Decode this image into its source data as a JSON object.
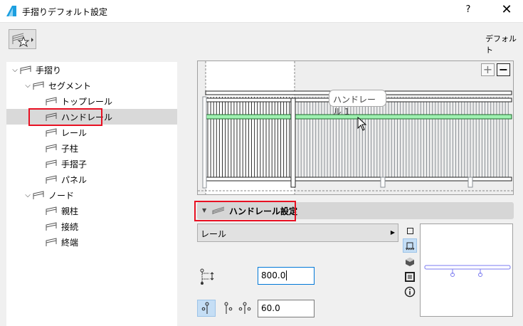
{
  "window": {
    "title": "手摺りデフォルト設定",
    "help": "?",
    "close": "✕"
  },
  "toolbar": {
    "default_label": "デフォルト"
  },
  "tree": [
    {
      "label": "手摺り",
      "level": 0,
      "expanded": true
    },
    {
      "label": "セグメント",
      "level": 1,
      "expanded": true
    },
    {
      "label": "トップレール",
      "level": 2
    },
    {
      "label": "ハンドレール",
      "level": 2,
      "selected": true
    },
    {
      "label": "レール",
      "level": 2
    },
    {
      "label": "子柱",
      "level": 2
    },
    {
      "label": "手摺子",
      "level": 2
    },
    {
      "label": "パネル",
      "level": 2
    },
    {
      "label": "ノード",
      "level": 1,
      "expanded": true
    },
    {
      "label": "親柱",
      "level": 2
    },
    {
      "label": "接続",
      "level": 2
    },
    {
      "label": "終端",
      "level": 2
    }
  ],
  "preview": {
    "tooltip": "ハンドレール 1",
    "zoom_in": "+",
    "zoom_out": "−"
  },
  "section": {
    "title": "ハンドレール設定"
  },
  "settings": {
    "rail_type": "レール",
    "height_value": "800.0",
    "offset_value": "60.0"
  },
  "colors": {
    "highlight": "#e81123",
    "handrail": "#9ef0b0",
    "selected_row": "#d9d9d9"
  }
}
